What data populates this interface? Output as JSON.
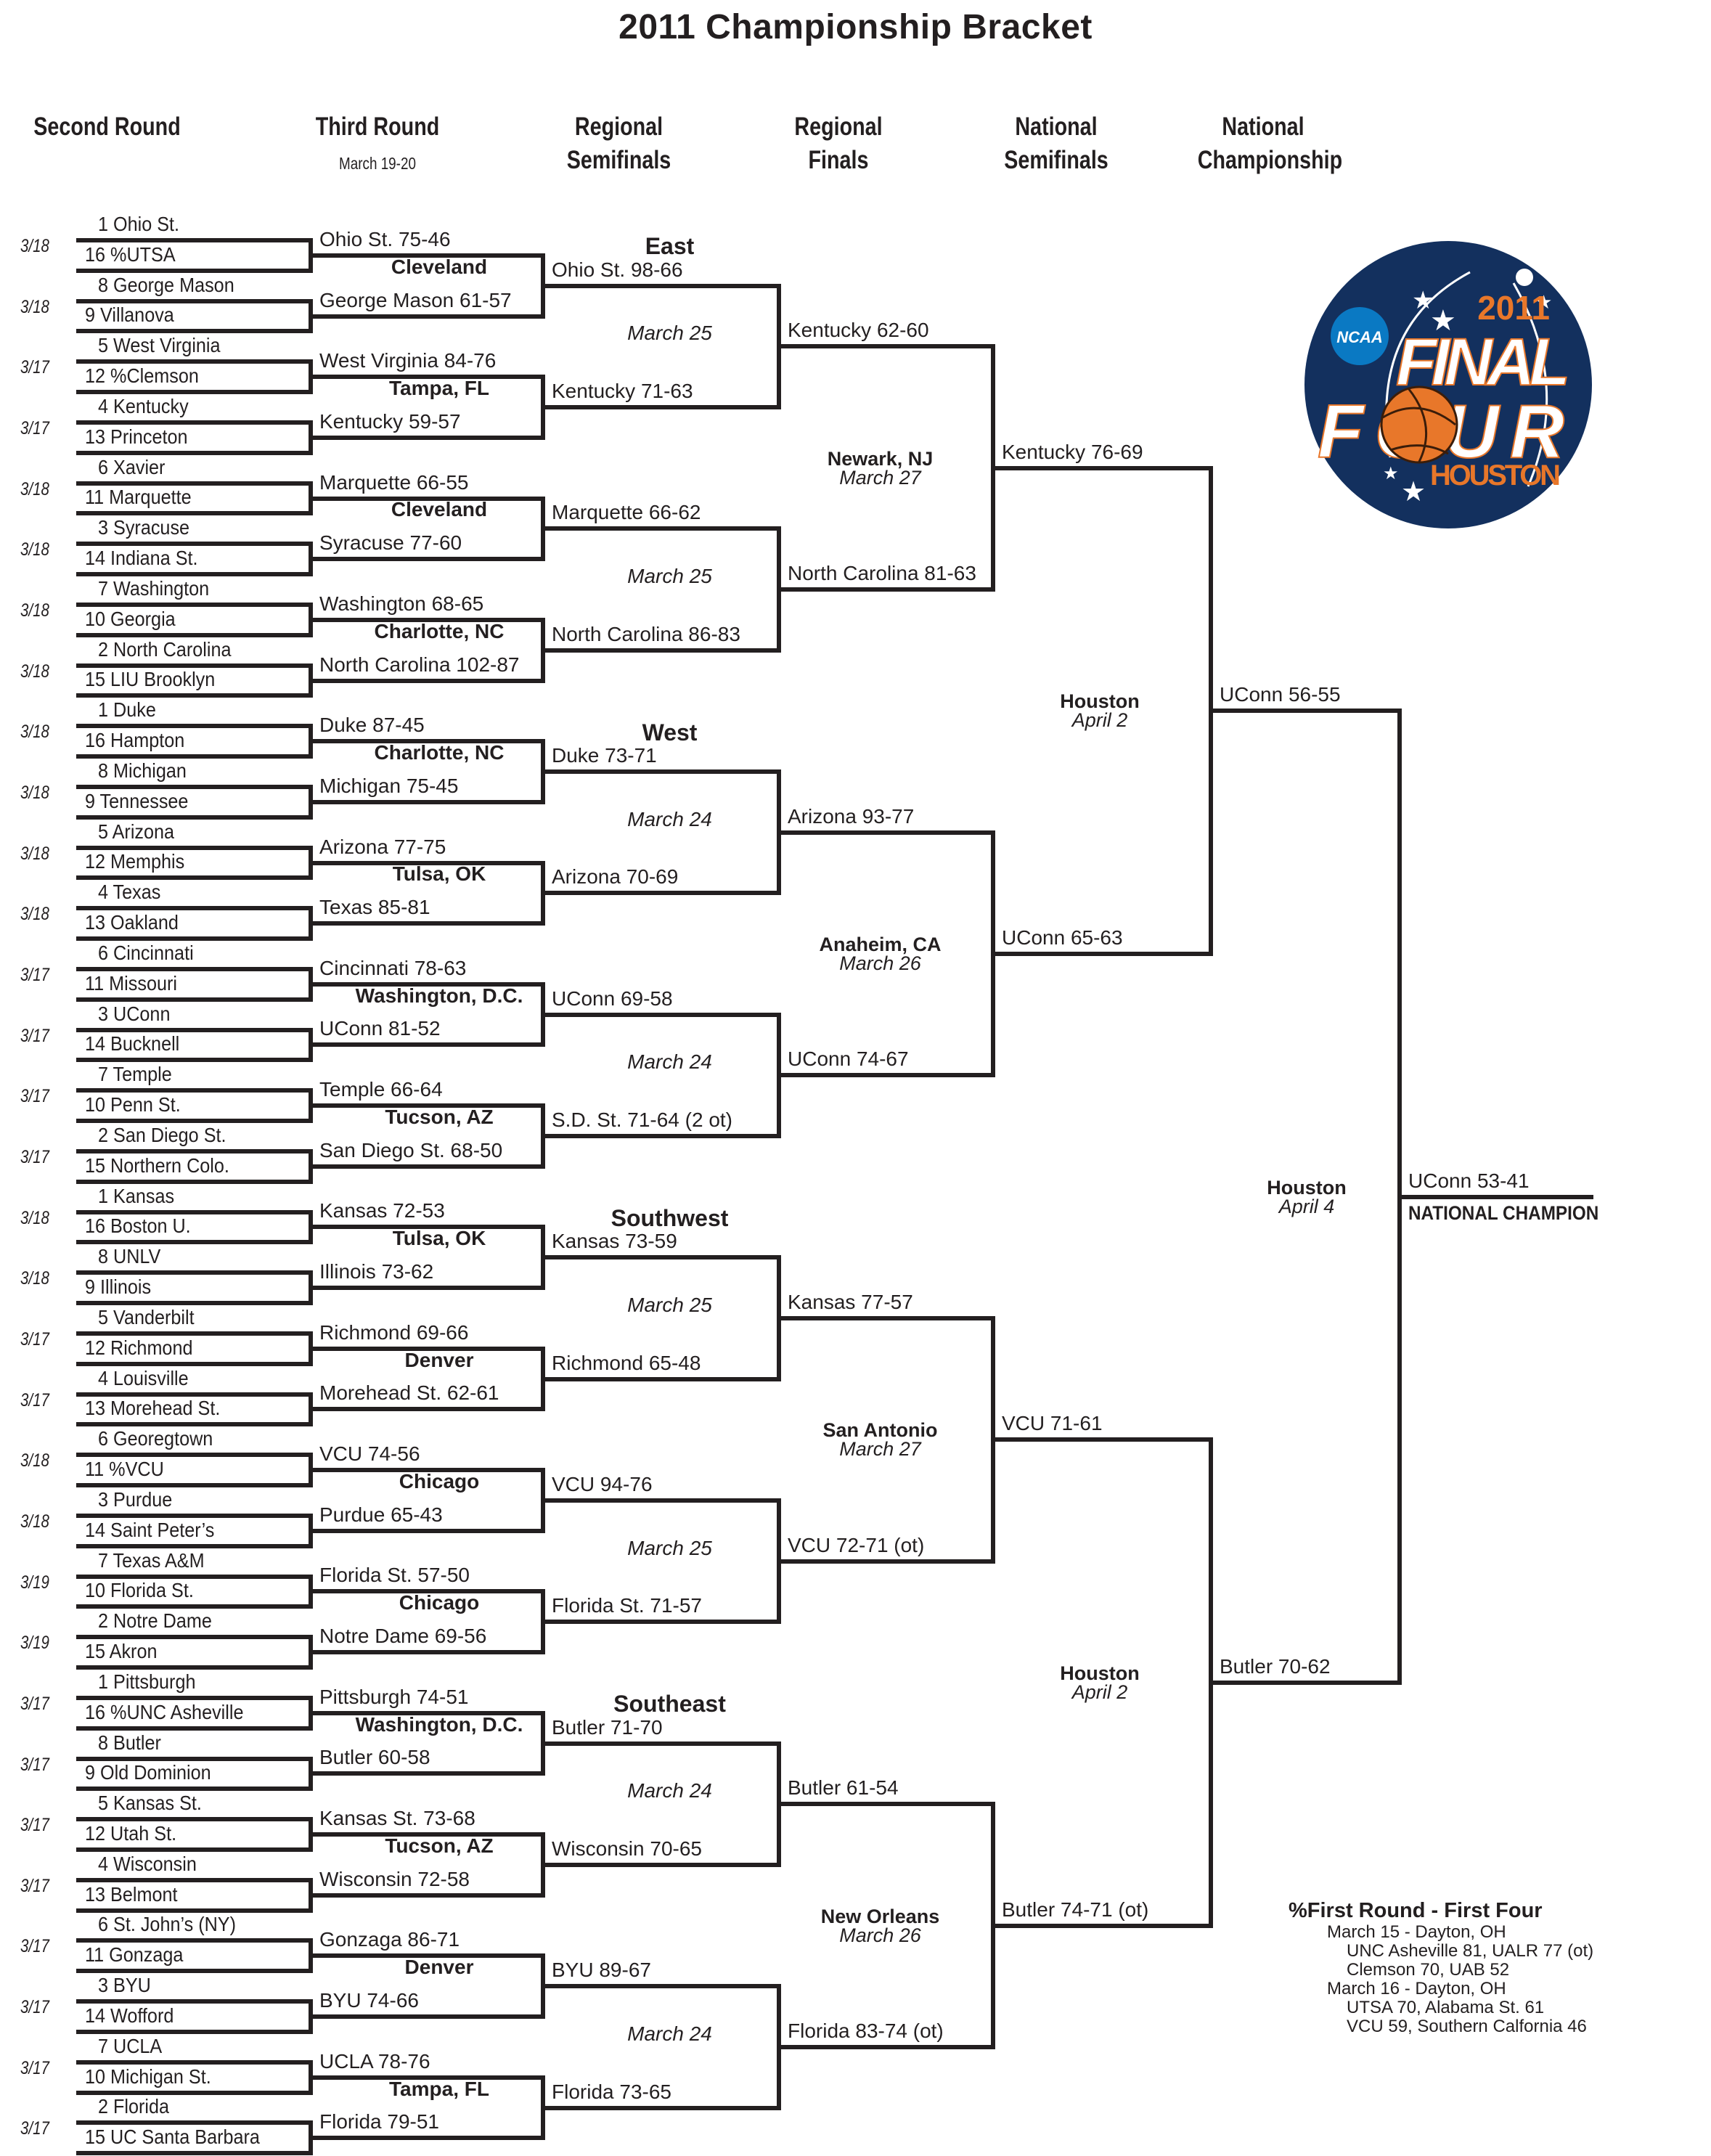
{
  "title": "2011 Championship Bracket",
  "columns": [
    {
      "label": "Second Round",
      "sub": ""
    },
    {
      "label": "Third Round",
      "sub": "March 19-20"
    },
    {
      "label": "Regional Semifinals",
      "sub": ""
    },
    {
      "label": "Regional Finals",
      "sub": ""
    },
    {
      "label": "National Semifinals",
      "sub": ""
    },
    {
      "label": "National Championship",
      "sub": ""
    }
  ],
  "second_round": [
    {
      "team": "1 Ohio St."
    },
    {
      "team": "16 %UTSA"
    },
    {
      "team": "8 George Mason"
    },
    {
      "team": "9 Villanova"
    },
    {
      "team": "5 West Virginia"
    },
    {
      "team": "12 %Clemson"
    },
    {
      "team": "4 Kentucky"
    },
    {
      "team": "13 Princeton"
    },
    {
      "team": "6 Xavier"
    },
    {
      "team": "11 Marquette"
    },
    {
      "team": "3 Syracuse"
    },
    {
      "team": "14 Indiana St."
    },
    {
      "team": "7 Washington"
    },
    {
      "team": "10 Georgia"
    },
    {
      "team": "2 North Carolina"
    },
    {
      "team": "15 LIU Brooklyn"
    },
    {
      "team": "1 Duke"
    },
    {
      "team": "16 Hampton"
    },
    {
      "team": "8 Michigan"
    },
    {
      "team": "9 Tennessee"
    },
    {
      "team": "5 Arizona"
    },
    {
      "team": "12 Memphis"
    },
    {
      "team": "4 Texas"
    },
    {
      "team": "13 Oakland"
    },
    {
      "team": "6 Cincinnati"
    },
    {
      "team": "11 Missouri"
    },
    {
      "team": "3 UConn"
    },
    {
      "team": "14 Bucknell"
    },
    {
      "team": "7 Temple"
    },
    {
      "team": "10 Penn St."
    },
    {
      "team": "2 San Diego St."
    },
    {
      "team": "15 Northern Colo."
    },
    {
      "team": "1 Kansas"
    },
    {
      "team": "16 Boston U."
    },
    {
      "team": "8 UNLV"
    },
    {
      "team": "9 Illinois"
    },
    {
      "team": "5 Vanderbilt"
    },
    {
      "team": "12 Richmond"
    },
    {
      "team": "4 Louisville"
    },
    {
      "team": "13 Morehead St."
    },
    {
      "team": "6 Georegtown"
    },
    {
      "team": "11 %VCU"
    },
    {
      "team": "3 Purdue"
    },
    {
      "team": "14 Saint Peter’s"
    },
    {
      "team": "7 Texas A&M"
    },
    {
      "team": "10 Florida St."
    },
    {
      "team": "2 Notre Dame"
    },
    {
      "team": "15 Akron"
    },
    {
      "team": "1 Pittsburgh"
    },
    {
      "team": "16 %UNC Asheville"
    },
    {
      "team": "8 Butler"
    },
    {
      "team": "9 Old Dominion"
    },
    {
      "team": "5 Kansas St."
    },
    {
      "team": "12 Utah St."
    },
    {
      "team": "4 Wisconsin"
    },
    {
      "team": "13 Belmont"
    },
    {
      "team": "6 St. John’s (NY)"
    },
    {
      "team": "11 Gonzaga"
    },
    {
      "team": "3 BYU"
    },
    {
      "team": "14 Wofford"
    },
    {
      "team": "7 UCLA"
    },
    {
      "team": "10 Michigan St."
    },
    {
      "team": "2 Florida"
    },
    {
      "team": "15 UC Santa Barbara"
    }
  ],
  "game_dates": [
    "3/18",
    "3/18",
    "3/17",
    "3/17",
    "3/18",
    "3/18",
    "3/18",
    "3/18",
    "3/18",
    "3/18",
    "3/18",
    "3/18",
    "3/17",
    "3/17",
    "3/17",
    "3/17",
    "3/18",
    "3/18",
    "3/17",
    "3/17",
    "3/18",
    "3/18",
    "3/19",
    "3/19",
    "3/17",
    "3/17",
    "3/17",
    "3/17",
    "3/17",
    "3/17",
    "3/17",
    "3/17"
  ],
  "third_round": [
    "Ohio St. 75-46",
    "George Mason 61-57",
    "West Virginia 84-76",
    "Kentucky 59-57",
    "Marquette 66-55",
    "Syracuse 77-60",
    "Washington 68-65",
    "North Carolina 102-87",
    "Duke 87-45",
    "Michigan 75-45",
    "Arizona 77-75",
    "Texas 85-81",
    "Cincinnati 78-63",
    "UConn 81-52",
    "Temple 66-64",
    "San Diego St. 68-50",
    "Kansas 72-53",
    "Illinois 73-62",
    "Richmond 69-66",
    "Morehead St. 62-61",
    "VCU 74-56",
    "Purdue 65-43",
    "Florida St. 57-50",
    "Notre Dame 69-56",
    "Pittsburgh 74-51",
    "Butler 60-58",
    "Kansas St. 73-68",
    "Wisconsin 72-58",
    "Gonzaga 86-71",
    "BYU 74-66",
    "UCLA 78-76",
    "Florida 79-51"
  ],
  "third_round_venues": [
    "Cleveland",
    "Tampa, FL",
    "Cleveland",
    "Charlotte, NC",
    "Charlotte, NC",
    "Tulsa, OK",
    "Washington, D.C.",
    "Tucson, AZ",
    "Tulsa, OK",
    "Denver",
    "Chicago",
    "Chicago",
    "Washington, D.C.",
    "Tucson, AZ",
    "Denver",
    "Tampa, FL"
  ],
  "regional_semifinals": [
    "Ohio St. 98-66",
    "Kentucky 71-63",
    "Marquette 66-62",
    "North Carolina 86-83",
    "Duke 73-71",
    "Arizona 70-69",
    "UConn 69-58",
    "S.D. St. 71-64 (2 ot)",
    "Kansas 73-59",
    "Richmond 65-48",
    "VCU 94-76",
    "Florida St. 71-57",
    "Butler 71-70",
    "Wisconsin 70-65",
    "BYU 89-67",
    "Florida 73-65"
  ],
  "regional_semifinal_dates": [
    "March 25",
    "March 25",
    "March 24",
    "March 24",
    "March 25",
    "March 25",
    "March 24",
    "March 24"
  ],
  "regional_finals": [
    "Kentucky 62-60",
    "North Carolina 81-63",
    "Arizona 93-77",
    "UConn 74-67",
    "Kansas 77-57",
    "VCU 72-71 (ot)",
    "Butler 61-54",
    "Florida 83-74 (ot)"
  ],
  "regions": [
    "East",
    "West",
    "Southwest",
    "Southeast"
  ],
  "regional_final_sites": [
    {
      "venue": "Newark, NJ",
      "date": "March 27"
    },
    {
      "venue": "Anaheim, CA",
      "date": "March 26"
    },
    {
      "venue": "San Antonio",
      "date": "March 27"
    },
    {
      "venue": "New Orleans",
      "date": "March 26"
    }
  ],
  "national_semifinals": [
    "Kentucky 76-69",
    "UConn 65-63",
    "VCU 71-61",
    "Butler 74-71 (ot)"
  ],
  "national_semifinal_sites": [
    {
      "venue": "Houston",
      "date": "April 2"
    },
    {
      "venue": "Houston",
      "date": "April 2"
    }
  ],
  "national_championship": [
    "UConn 56-55",
    "Butler 70-62"
  ],
  "championship_site": {
    "venue": "Houston",
    "date": "April 4"
  },
  "champion": {
    "result": "UConn 53-41",
    "label": "NATIONAL CHAMPION"
  },
  "logo": {
    "org": "NCAA",
    "year": "2011",
    "line1": "FINAL",
    "line2": "FOUR",
    "city": "HOUSTON",
    "colors": {
      "navy": "#13305e",
      "orange": "#e8772a",
      "blue": "#0a79c3"
    }
  },
  "first_four": {
    "heading": "%First Round - First Four",
    "days": [
      {
        "label": "March 15 - Dayton, OH",
        "games": [
          "UNC Asheville 81, UALR 77 (ot)",
          "Clemson 70, UAB 52"
        ]
      },
      {
        "label": "March 16 - Dayton, OH",
        "games": [
          "UTSA 70, Alabama St. 61",
          "VCU 59, Southern Calfornia 46"
        ]
      }
    ]
  }
}
